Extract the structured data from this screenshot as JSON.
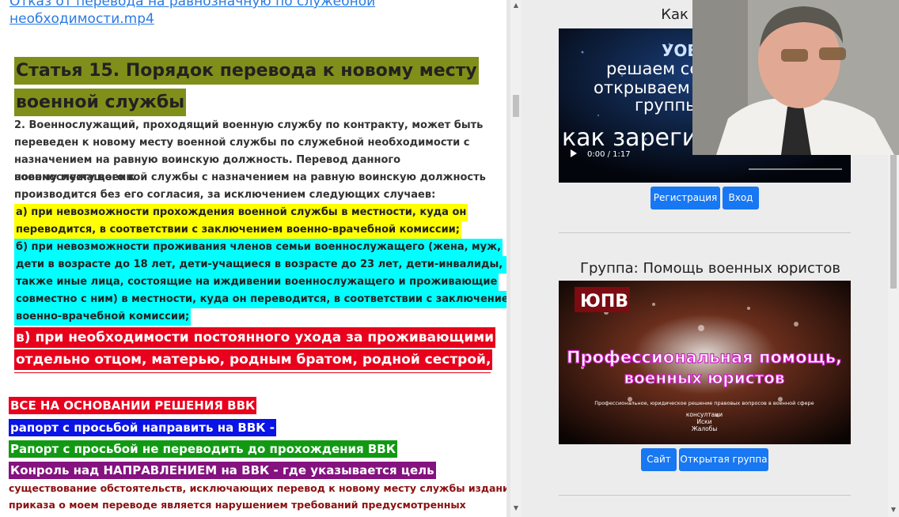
{
  "left": {
    "video_link_line1": "Отказ от перевода на равнозначную по служебной",
    "video_link_line2": "необходимости.mp4",
    "article_title_line1": "Статья 15. Порядок перевода к новому месту",
    "article_title_line2": "военной службы",
    "paragraph_lines": [
      "2. Военнослужащий, проходящий военную службу по контракту, может быть",
      "переведен к новому месту военной службы по служебной необходимости с",
      "назначением на равную воинскую должность. Перевод данного военнослужащего к",
      "новому месту военной службы с назначением на равную воинскую должность",
      "производится без его согласия, за исключением следующих случаев:"
    ],
    "item_a_lines": [
      "а) при невозможности прохождения военной службы в местности, куда он",
      "переводится, в соответствии с заключением военно-врачебной комиссии;"
    ],
    "item_b_lines": [
      "б) при невозможности проживания членов семьи военнослужащего (жена, муж,",
      "дети в возрасте до 18 лет, дети-учащиеся в возрасте до 23 лет, дети-инвалиды, а",
      "также иные лица, состоящие на иждивении военнослужащего и проживающие",
      "совместно с ним) в местности, куда он переводится, в соответствии с заключением",
      "военно-врачебной комиссии;"
    ],
    "item_c_lines": [
      "в) при необходимости постоянного ухода за проживающими",
      "отдельно отцом, матерью, родным братом, родной сестрой,"
    ],
    "tag_red": "ВСЕ НА ОСНОВАНИИ РЕШЕНИЯ ВВК",
    "tag_blue": "рапорт с просьбой направить на ВВК -",
    "tag_green": "Рапорт с просьбой не переводить до прохождения ВВК",
    "tag_purple": "Конроль над НАПРАВЛЕНИЕМ на ВВК - где указывается цель",
    "dark_lines": [
      "существование обстоятельств, исключающих перевод к новому месту службы издание",
      "приказа о моем переводе является нарушением требований предусмотренных"
    ]
  },
  "right": {
    "section1_title": "Как зарегис",
    "video1": {
      "overlay_text": [
        "УОЕН",
        "решаем се",
        "открываем с",
        "группь",
        "как зарегис"
      ],
      "time": "0:00 / 1:17"
    },
    "btn_register": "Регистрация",
    "btn_login": "Вход",
    "section2_title": "Группа: Помощь военных юристов",
    "banner": {
      "badge": "ЮПВ",
      "headline_line1": "Профессиональная помощь,",
      "headline_line2": "военных юристов",
      "subline": "Профессиональное, юридическое решение правовых вопросов в военной сфере",
      "items": [
        "консултаци",
        "Иски",
        "Жалобы"
      ]
    },
    "btn_site": "Сайт",
    "btn_open_group": "Открытая группа"
  }
}
